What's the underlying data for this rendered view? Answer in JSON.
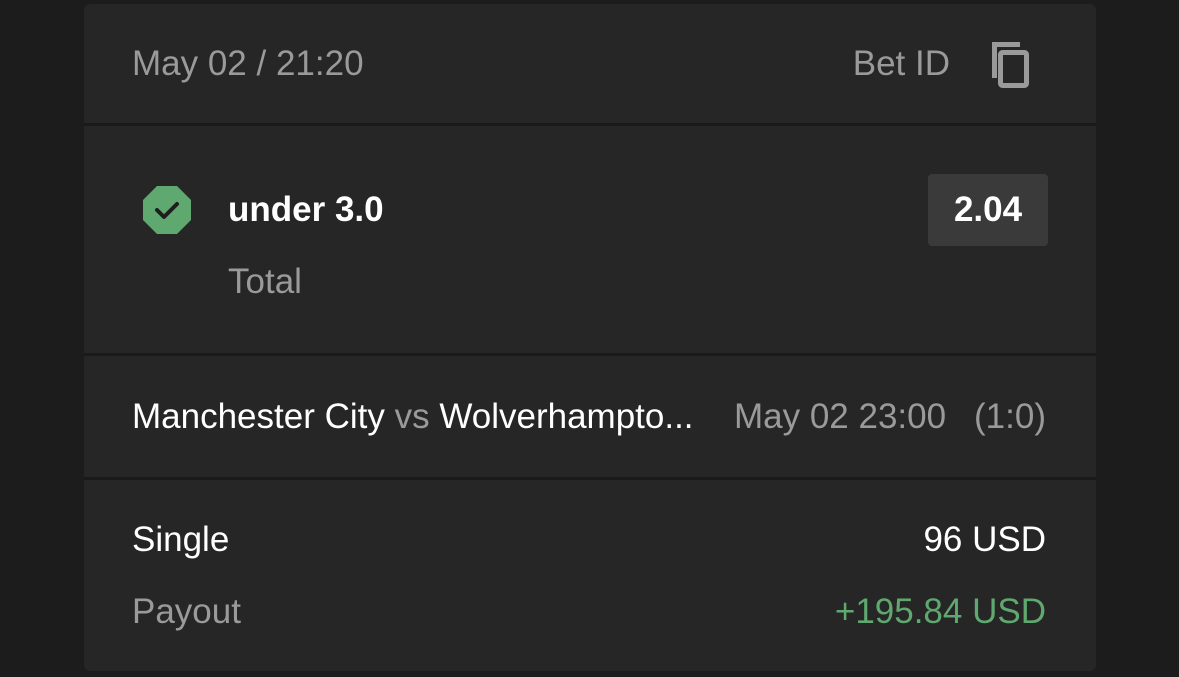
{
  "header": {
    "datetime": "May 02 / 21:20",
    "bet_id_label": "Bet ID",
    "copy_icon": "copy-icon"
  },
  "selection": {
    "status_icon": "check-octagon-icon",
    "status_color": "#5fa86f",
    "name": "under 3.0",
    "market": "Total",
    "odds": "2.04"
  },
  "match": {
    "home": "Manchester City",
    "vs": "vs",
    "away": "Wolverhampto...",
    "time": "May 02 23:00",
    "score": "(1:0)"
  },
  "summary": {
    "bet_type": "Single",
    "stake": "96 USD",
    "payout_label": "Payout",
    "payout_value": "+195.84 USD",
    "payout_color": "#5fa86f"
  }
}
